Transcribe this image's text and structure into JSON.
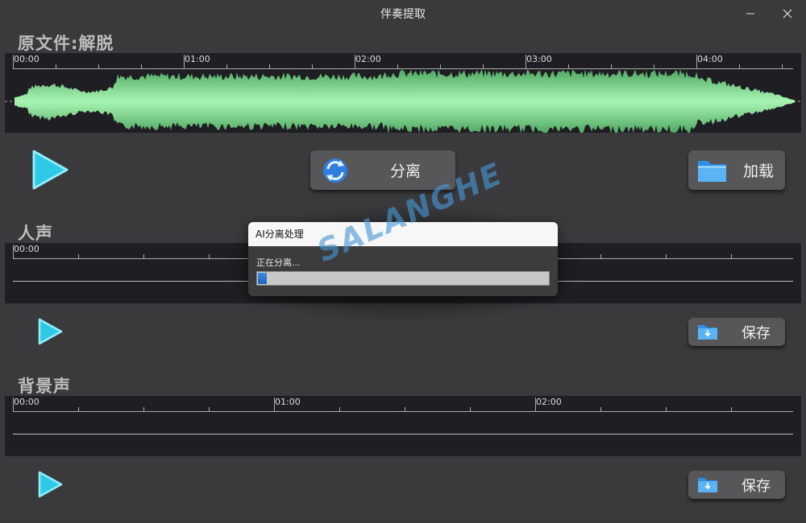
{
  "window": {
    "title": "伴奏提取"
  },
  "original": {
    "label": "原文件:解脱",
    "ticks": [
      "00:00",
      "01:00",
      "02:00",
      "03:00",
      "04:00"
    ],
    "separate_label": "分离",
    "load_label": "加载"
  },
  "vocals": {
    "label": "人声",
    "ticks": [
      "00:00"
    ],
    "save_label": "保存"
  },
  "background": {
    "label": "背景声",
    "ticks": [
      "00:00",
      "01:00",
      "02:00"
    ],
    "save_label": "保存"
  },
  "dialog": {
    "title": "AI分离处理",
    "message": "正在分离...",
    "progress": 0.03
  },
  "watermark": "SALANGHE",
  "colors": {
    "waveform": "#8fe89a",
    "play": "#3fd8ee",
    "folder": "#4aa6f0",
    "track_bg": "#1f1e22",
    "window_bg": "#3a3a3d"
  },
  "icons": {
    "play": "play-icon",
    "separate": "refresh-icon",
    "load": "folder-icon",
    "save": "folder-download-icon",
    "minimize": "minimize-icon",
    "close": "close-icon"
  }
}
